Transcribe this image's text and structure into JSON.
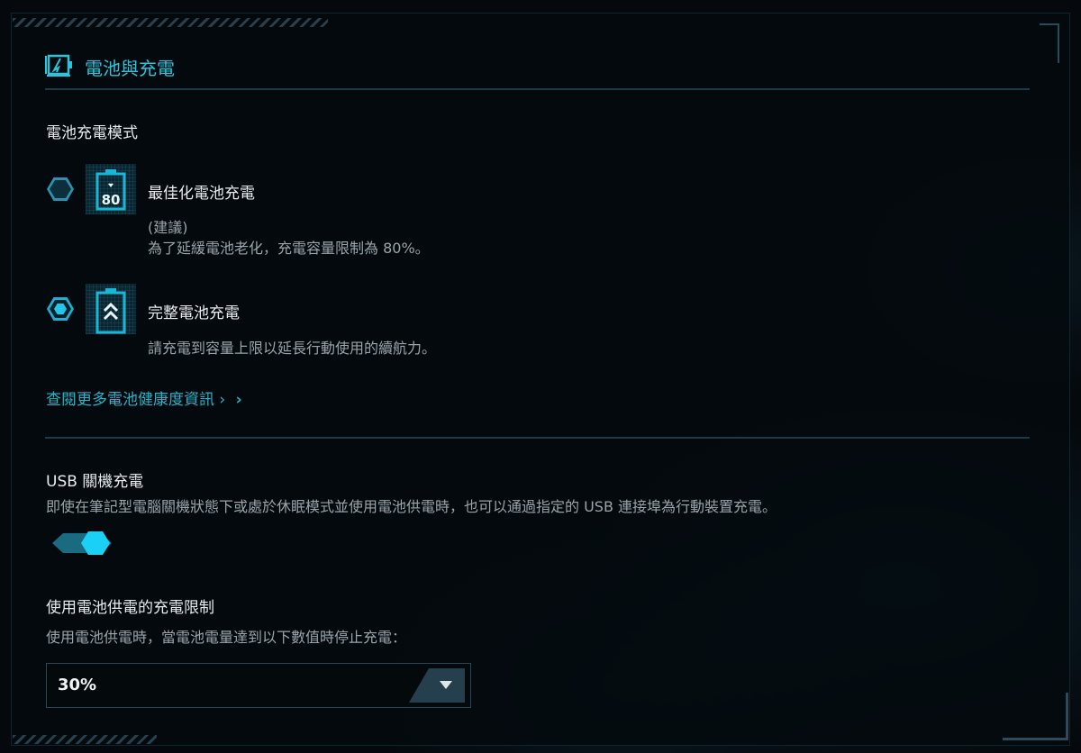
{
  "header": {
    "title": "電池與充電",
    "icon": "battery-charging-icon"
  },
  "charging_mode": {
    "label": "電池充電模式",
    "options": [
      {
        "title": "最佳化電池充電",
        "note": "(建議)",
        "desc": "為了延緩電池老化，充電容量限制為 80%。",
        "icon_text": "80",
        "selected": false
      },
      {
        "title": "完整電池充電",
        "desc": "請充電到容量上限以延長行動使用的續航力。",
        "selected": true
      }
    ],
    "link": "查閱更多電池健康度資訊 ›",
    "link_arrow": "›"
  },
  "usb_charging": {
    "title": "USB 關機充電",
    "desc": "即使在筆記型電腦關機狀態下或處於休眠模式並使用電池供電時，也可以通過指定的 USB 連接埠為行動裝置充電。",
    "enabled": true
  },
  "battery_limit": {
    "title": "使用電池供電的充電限制",
    "desc": "使用電池供電時，當電池電量達到以下數值時停止充電：",
    "value": "30%"
  },
  "colors": {
    "accent": "#2bc4dd",
    "bg": "#05090d"
  }
}
